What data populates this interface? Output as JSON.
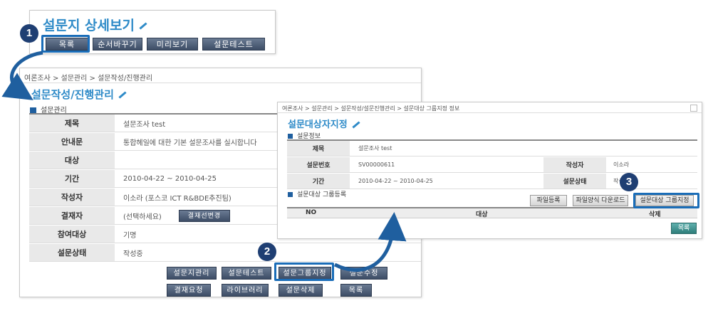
{
  "top": {
    "title": "설문지 상세보기",
    "buttons": [
      "목록",
      "순서바꾸기",
      "미리보기",
      "설문테스트"
    ]
  },
  "steps": [
    "1",
    "2",
    "3"
  ],
  "mid": {
    "breadcrumb": "여론조사 > 설문관리 > 설문작성/진행관리",
    "title": "설문작성/진행관리",
    "section": "설문관리",
    "rows": [
      {
        "label": "제목",
        "value": "설문조사 test"
      },
      {
        "label": "안내문",
        "value": "통합헤일에 대한 기본 설문조사를 실시합니다"
      },
      {
        "label": "대상",
        "value": ""
      },
      {
        "label": "기간",
        "value": "2010-04-22 ~ 2010-04-25"
      },
      {
        "label": "작성자",
        "value": "이소라 (포스코 ICT R&BDE추진팀)"
      },
      {
        "label": "결재자",
        "value": "(선택하세요)"
      },
      {
        "label": "참여대상",
        "value": "기명"
      },
      {
        "label": "설문상태",
        "value": "작성중"
      }
    ],
    "approver_button": "결재선변경",
    "buttons_row1": [
      "설문지관리",
      "설문테스트",
      "설문그룹지정",
      "설문수정"
    ],
    "buttons_row2": [
      "결재요청",
      "라이브러리",
      "설문삭제",
      "목록"
    ]
  },
  "right": {
    "breadcrumb": "여론조사 > 설문관리 > 설문작성/설문진행관리 > 설문대상 그룹지정 정보",
    "title": "설문대상자지정",
    "section1": "설문정보",
    "info": {
      "title_label": "제목",
      "title_value": "설문조사 test",
      "number_label": "설문번호",
      "number_value": "SV00000611",
      "author_label": "작성자",
      "author_value": "이소라",
      "period_label": "기간",
      "period_value": "2010-04-22 ~ 2010-04-25",
      "status_label": "설문상태",
      "status_value": "작성중"
    },
    "section2": "설문대상 그룹등록",
    "buttons": [
      "파일등록",
      "파일양식 다운로드",
      "설문대상 그룹지정"
    ],
    "table_headers": [
      "NO",
      "대상",
      "삭제"
    ],
    "list_button": "목록"
  }
}
